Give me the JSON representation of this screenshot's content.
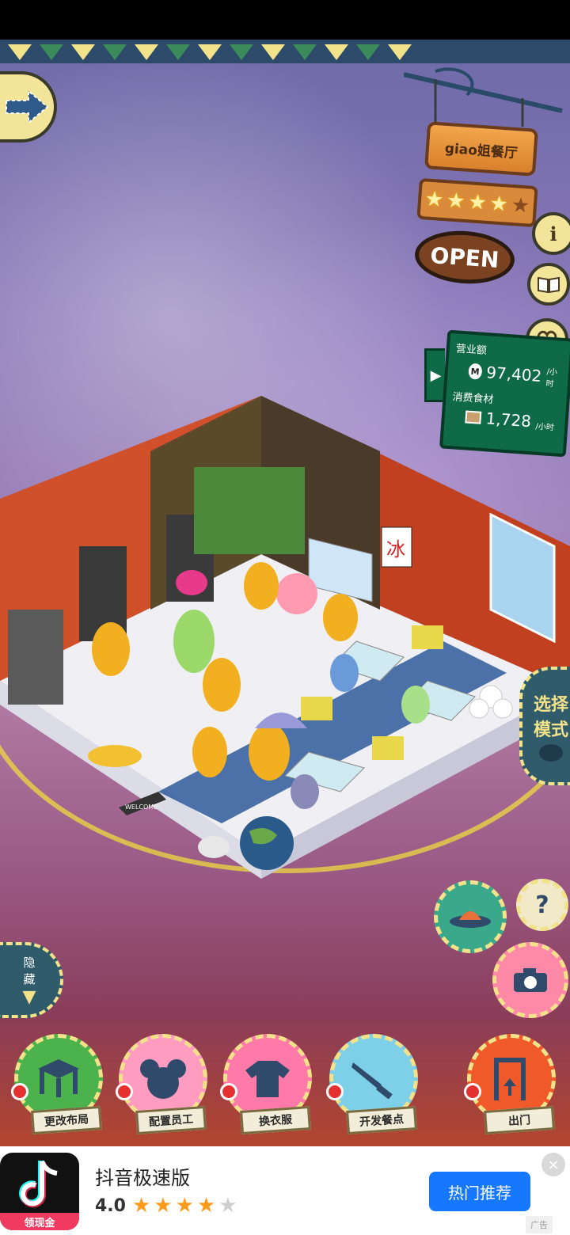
{
  "restaurant": {
    "name": "giao姐餐厅",
    "rating": 4,
    "rating_max": 5,
    "open_label": "OPEN"
  },
  "stats": {
    "revenue_label": "营业额",
    "revenue_value": "97,402",
    "revenue_unit": "/小时",
    "ingredients_label": "消费食材",
    "ingredients_value": "1,728",
    "ingredients_unit": "/小时",
    "coin_symbol": "M"
  },
  "side_buttons": {
    "info_icon": "i",
    "help_icon": "?"
  },
  "select_mode": {
    "line1": "选择",
    "line2": "模式"
  },
  "hide_button": {
    "line1": "隐",
    "line2": "藏"
  },
  "bottom_menu": [
    {
      "label": "更改布局",
      "icon": "table-icon",
      "color": "#4cb24c"
    },
    {
      "label": "配置员工",
      "icon": "mouse-head-icon",
      "color": "#ff9cc0"
    },
    {
      "label": "换衣服",
      "icon": "shirt-icon",
      "color": "#ff7aa8"
    },
    {
      "label": "开发餐点",
      "icon": "knife-icon",
      "color": "#7ed0e8"
    },
    {
      "label": "出门",
      "icon": "door-icon",
      "color": "#f05a2a"
    }
  ],
  "scene": {
    "shaved_ice_sign": "冰",
    "welcome_mat": "WELCOME"
  },
  "ad": {
    "app_name": "抖音极速版",
    "rating": "4.0",
    "stars_filled": 4,
    "stars_total": 5,
    "icon_tag": "领现金",
    "cta": "热门推荐",
    "close_icon": "×",
    "ad_mark": "广告"
  },
  "colors": {
    "ad_cta": "#1677ff",
    "board_green": "#0f6a48",
    "sign_wood": "#d9802c"
  }
}
